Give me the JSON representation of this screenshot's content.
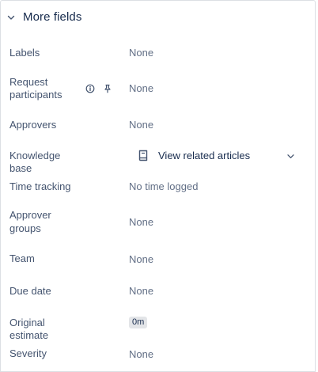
{
  "section": {
    "title": "More fields"
  },
  "fields": {
    "labels": {
      "label": "Labels",
      "value": "None"
    },
    "request_participants": {
      "label_line1": "Request",
      "label_line2": "participants",
      "value": "None"
    },
    "approvers": {
      "label": "Approvers",
      "value": "None"
    },
    "knowledge_base": {
      "label": "Knowledge base",
      "value": "View related articles"
    },
    "time_tracking": {
      "label": "Time tracking",
      "value": "No time logged"
    },
    "approver_groups": {
      "label_line1": "Approver",
      "label_line2": "groups",
      "value": "None"
    },
    "team": {
      "label": "Team",
      "value": "None"
    },
    "due_date": {
      "label": "Due date",
      "value": "None"
    },
    "original_estimate": {
      "label": "Original estimate",
      "value": "0m"
    },
    "severity": {
      "label": "Severity",
      "value": "None"
    }
  },
  "icons": {
    "section_toggle": "chevron-down-icon",
    "participants_info": "info-icon",
    "participants_pin": "pin-icon",
    "knowledge_base": "book-icon",
    "knowledge_base_dropdown": "chevron-down-icon"
  }
}
